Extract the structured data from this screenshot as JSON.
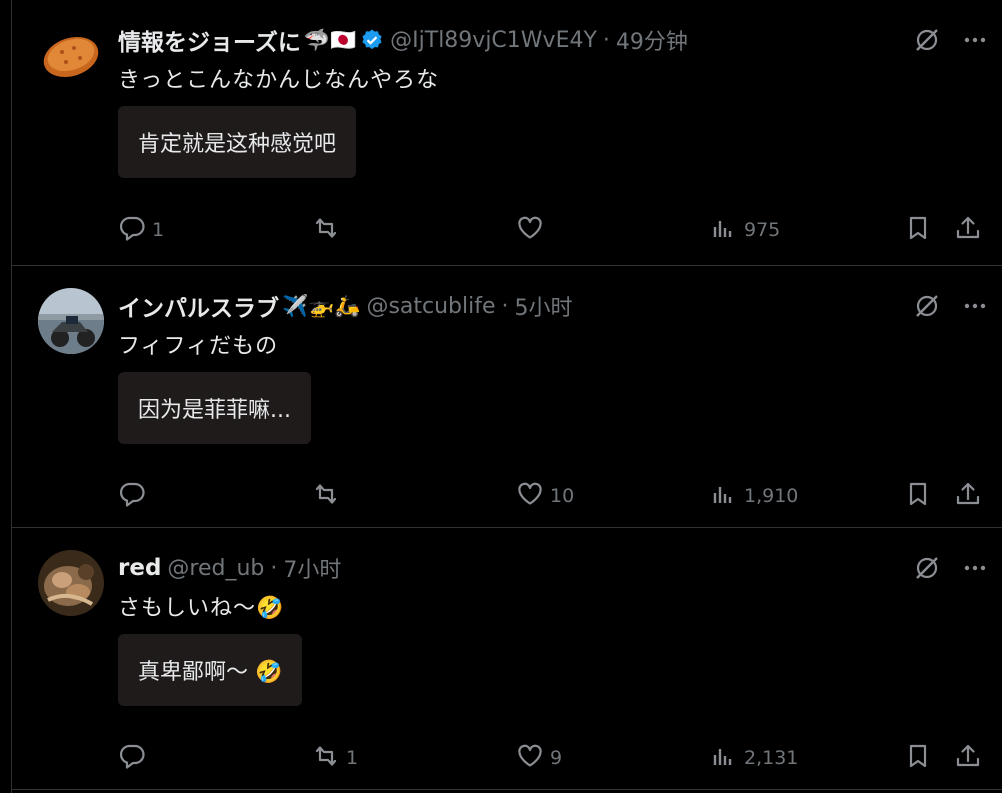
{
  "tweets": [
    {
      "name": "情報をジョーズに",
      "emojis": "🦈🇯🇵",
      "verified": true,
      "handle": "@IjTl89vjC1WvE4Y",
      "time": "49分钟",
      "text": "きっとこんなかんじなんやろな",
      "translation": "肯定就是这种感觉吧",
      "replies": "1",
      "retweets": "",
      "likes": "",
      "views": "975",
      "avatar_icon": "croquette-avatar"
    },
    {
      "name": "インパルスラブ",
      "emojis": "✈️🚁🛵",
      "verified": false,
      "handle": "@satcublife",
      "time": "5小时",
      "text": "フィフィだもの",
      "translation": "因为是菲菲嘛...",
      "replies": "",
      "retweets": "",
      "likes": "10",
      "views": "1,910",
      "avatar_icon": "motorcycle-avatar"
    },
    {
      "name": "red",
      "emojis": "",
      "verified": false,
      "handle": "@red_ub",
      "time": "7小时",
      "text": "さもしいね〜🤣",
      "translation": "真卑鄙啊〜 🤣",
      "replies": "",
      "retweets": "1",
      "likes": "9",
      "views": "2,131",
      "avatar_icon": "painting-avatar"
    }
  ],
  "separator": "·",
  "icons": {
    "top": [
      "grok-icon",
      "more-icon"
    ],
    "actions": [
      "reply-icon",
      "retweet-icon",
      "like-icon",
      "views-icon",
      "bookmark-icon",
      "share-icon"
    ]
  },
  "colors": {
    "background": "#000000",
    "text": "#e7e9ea",
    "secondary": "#71767b",
    "border": "#2f3336",
    "translation_bg": "#1f1b1b",
    "verified": "#1d9bf0"
  }
}
